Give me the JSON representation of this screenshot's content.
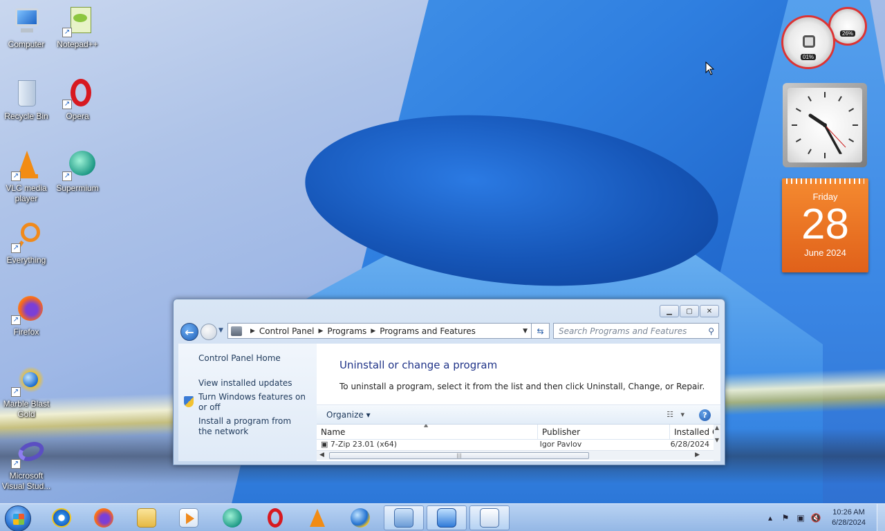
{
  "desktop": {
    "icons": [
      {
        "label": "Computer"
      },
      {
        "label": "Notepad++"
      },
      {
        "label": "Recycle Bin"
      },
      {
        "label": "Opera"
      },
      {
        "label": "VLC media player"
      },
      {
        "label": "Supermium"
      },
      {
        "label": "Everything"
      },
      {
        "label": "Firefox"
      },
      {
        "label": "Marble Blast Gold"
      },
      {
        "label": "Microsoft Visual Stud..."
      }
    ]
  },
  "gadgets": {
    "cpu_meter": {
      "cpu": "01%",
      "memory": "26%"
    },
    "calendar": {
      "weekday": "Friday",
      "day": "28",
      "month_year": "June 2024",
      "color": "#e8691f"
    }
  },
  "window": {
    "address": {
      "crumbs": [
        "Control Panel",
        "Programs",
        "Programs and Features"
      ]
    },
    "search_placeholder": "Search Programs and Features",
    "left_pane": {
      "home": "Control Panel Home",
      "links": [
        "View installed updates",
        "Turn Windows features on or off",
        "Install a program from the network"
      ]
    },
    "title": "Uninstall or change a program",
    "description": "To uninstall a program, select it from the list and then click Uninstall, Change, or Repair.",
    "toolbar": {
      "organize": "Organize",
      "help": "?"
    },
    "columns": [
      "Name",
      "Publisher",
      "Installed On"
    ],
    "rows": [
      {
        "name": "7-Zip 23.01 (x64)",
        "publisher": "Igor Pavlov",
        "installed": "6/28/2024"
      }
    ]
  },
  "taskbar": {
    "clock_time": "10:26 AM",
    "clock_date": "6/28/2024"
  }
}
